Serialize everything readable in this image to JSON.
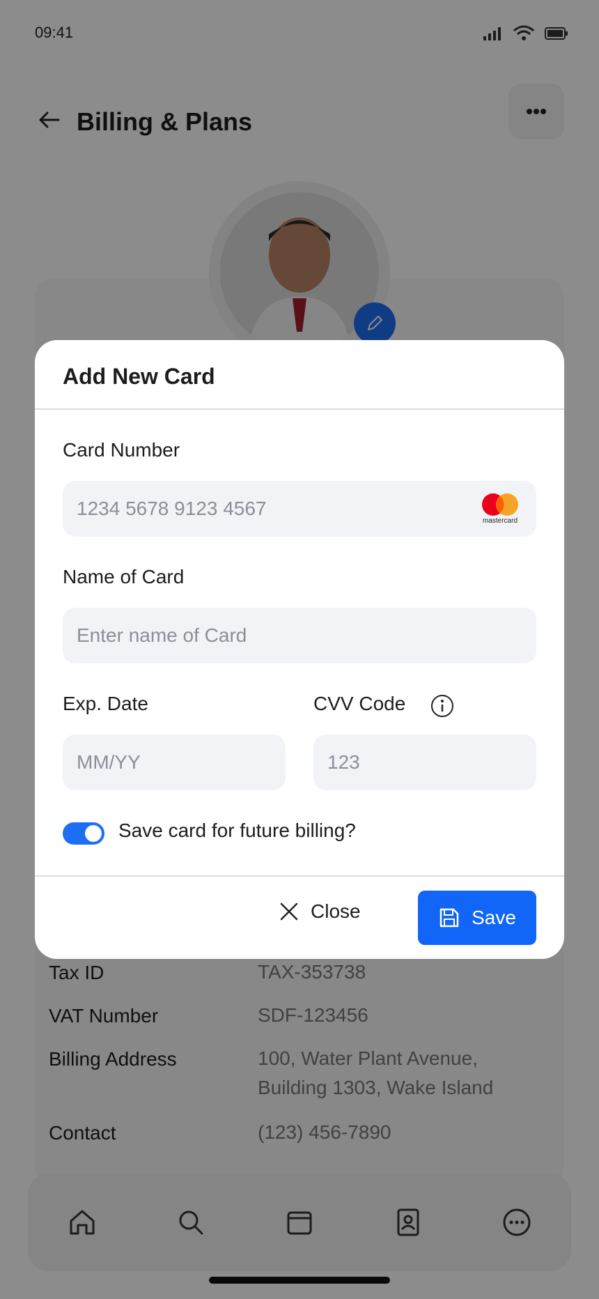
{
  "status_bar": {
    "time": "09:41"
  },
  "header": {
    "title": "Billing & Plans"
  },
  "info_rows": [
    {
      "key": "Tax ID",
      "value": "TAX-353738"
    },
    {
      "key": "VAT Number",
      "value": "SDF-123456"
    },
    {
      "key": "Billing Address",
      "value": "100, Water Plant Avenue, Building 1303, Wake Island"
    },
    {
      "key": "Contact",
      "value": "(123) 456-7890"
    }
  ],
  "modal": {
    "title": "Add New Card",
    "card_number_label": "Card Number",
    "card_number_placeholder": "1234 5678 9123 4567",
    "card_brand": "mastercard",
    "name_label": "Name of Card",
    "name_placeholder": "Enter name of Card",
    "exp_label": "Exp. Date",
    "exp_placeholder": "MM/YY",
    "cvv_label": "CVV Code",
    "cvv_placeholder": "123",
    "save_toggle_label": "Save card for future billing?",
    "save_toggle_on": true,
    "close_label": "Close",
    "save_label": "Save"
  },
  "colors": {
    "accent": "#1165F7",
    "overlay": "rgba(0,0,0,0.45)"
  }
}
